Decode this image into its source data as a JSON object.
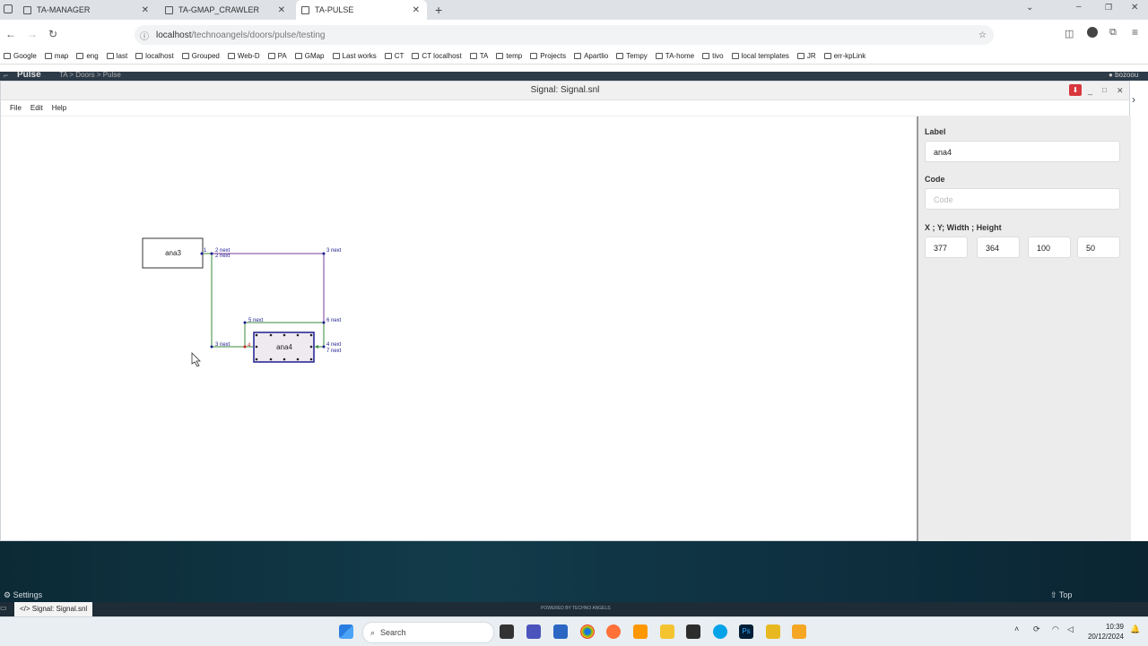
{
  "browser": {
    "tabs": [
      {
        "label": "TA-MANAGER",
        "active": false
      },
      {
        "label": "TA-GMAP_CRAWLER",
        "active": false
      },
      {
        "label": "TA-PULSE",
        "active": true
      }
    ],
    "url_host": "localhost",
    "url_path": "/technoangels/doors/pulse/testing",
    "bookmarks": [
      "Google",
      "map",
      "eng",
      "last",
      "localhost",
      "Grouped",
      "Web-D",
      "PA",
      "GMap",
      "Last works",
      "CT",
      "CT localhost",
      "TA",
      "temp",
      "Projects",
      "Apartlio",
      "Tempy",
      "TA-home",
      "tivo",
      "local templates",
      "JR",
      "err-kpLink"
    ]
  },
  "app": {
    "name": "Pulse",
    "breadcrumb": "TA > Doors > Pulse",
    "user": "bozoou"
  },
  "window": {
    "title": "Signal: Signal.snl",
    "menu": [
      "File",
      "Edit",
      "Help"
    ]
  },
  "diagram": {
    "nodes": [
      {
        "label": "ana3",
        "selected": false
      },
      {
        "label": "ana4",
        "selected": true
      }
    ],
    "ports": {
      "p1": "1",
      "p2a": "2 next",
      "p2b": "2 next",
      "p3a": "3 next",
      "p3b": "3 next",
      "p4": "4",
      "p5": "5 next",
      "p6": "6 next",
      "p4n": "4 next",
      "p7": "7 next"
    },
    "colors": {
      "green": "#3a8a3a",
      "purple": "#7a3c9a",
      "blue": "#1d1d8f",
      "red": "#cc2222"
    }
  },
  "panel": {
    "label_title": "Label",
    "label_value": "ana4",
    "code_title": "Code",
    "code_placeholder": "Code",
    "xywh_title": "X ; Y; Width ; Height",
    "x": "377",
    "y": "364",
    "width": "100",
    "height": "50"
  },
  "footer": {
    "settings": "Settings",
    "top": "Top",
    "powered": "POWERED BY TECHNO ANGELS",
    "task_item": "Signal: Signal.snl"
  },
  "taskbar": {
    "search": "Search",
    "time": "10:39",
    "date": "20/12/2024"
  }
}
